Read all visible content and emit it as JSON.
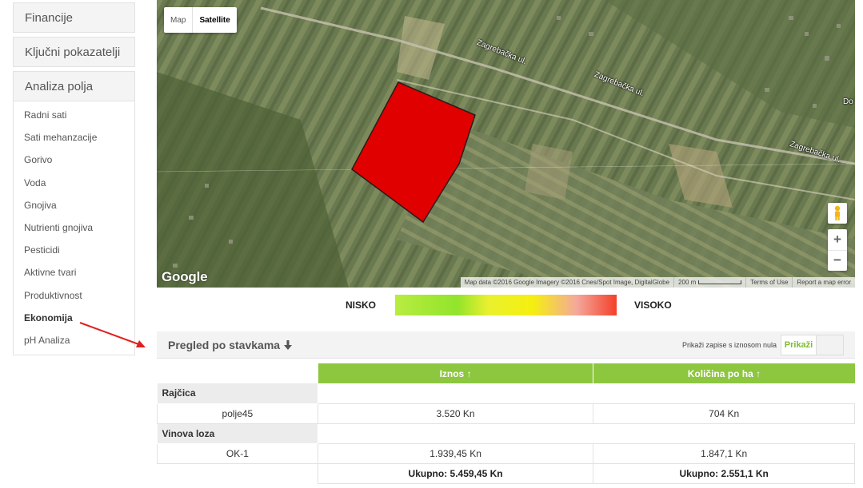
{
  "sidebar": {
    "top_items": [
      "Financije",
      "Ključni pokazatelji"
    ],
    "open_item": "Analiza polja",
    "sub_items": [
      "Radni sati",
      "Sati mehanzacije",
      "Gorivo",
      "Voda",
      "Gnojiva",
      "Nutrienti gnojiva",
      "Pesticidi",
      "Aktivne tvari",
      "Produktivnost",
      "Ekonomija",
      "pH Analiza"
    ],
    "active_sub_item": "Ekonomija"
  },
  "map": {
    "type_buttons": [
      "Map",
      "Satellite"
    ],
    "selected_type": "Satellite",
    "road_labels": [
      "Zagrebačka ul.",
      "Zagrebačka ul.",
      "Zagrebačka ul.",
      "Do"
    ],
    "logo_text": "Google",
    "attribution": {
      "data": "Map data ©2016 Google Imagery ©2016 Cnes/Spot Image, DigitalGlobe",
      "scale": "200 m",
      "terms": "Terms of Use",
      "report": "Report a map error"
    },
    "zoom_in": "+",
    "zoom_out": "−",
    "field_color": "#e00000",
    "icons": [
      "pegman-icon",
      "zoom-in-icon",
      "zoom-out-icon"
    ]
  },
  "legend": {
    "low": "NISKO",
    "high": "VISOKO"
  },
  "section": {
    "title": "Pregled po stavkama",
    "title_icon": "arrow-down-icon",
    "zero_label": "Prikaži zapise s iznosom nula",
    "toggle_label": "Prikaži"
  },
  "table": {
    "headers": [
      "Iznos ↑",
      "Količina po ha ↑"
    ],
    "groups": [
      {
        "name": "Rajčica",
        "rows": [
          {
            "field": "polje45",
            "amount": "3.520 Kn",
            "per_ha": "704 Kn"
          }
        ]
      },
      {
        "name": "Vinova loza",
        "rows": [
          {
            "field": "OK-1",
            "amount": "1.939,45 Kn",
            "per_ha": "1.847,1 Kn"
          }
        ]
      }
    ],
    "totals": {
      "amount": "Ukupno: 5.459,45 Kn",
      "per_ha": "Ukupno: 2.551,1 Kn"
    }
  },
  "colors": {
    "accent_green": "#8dc63f",
    "annotation_red": "#e02020"
  }
}
